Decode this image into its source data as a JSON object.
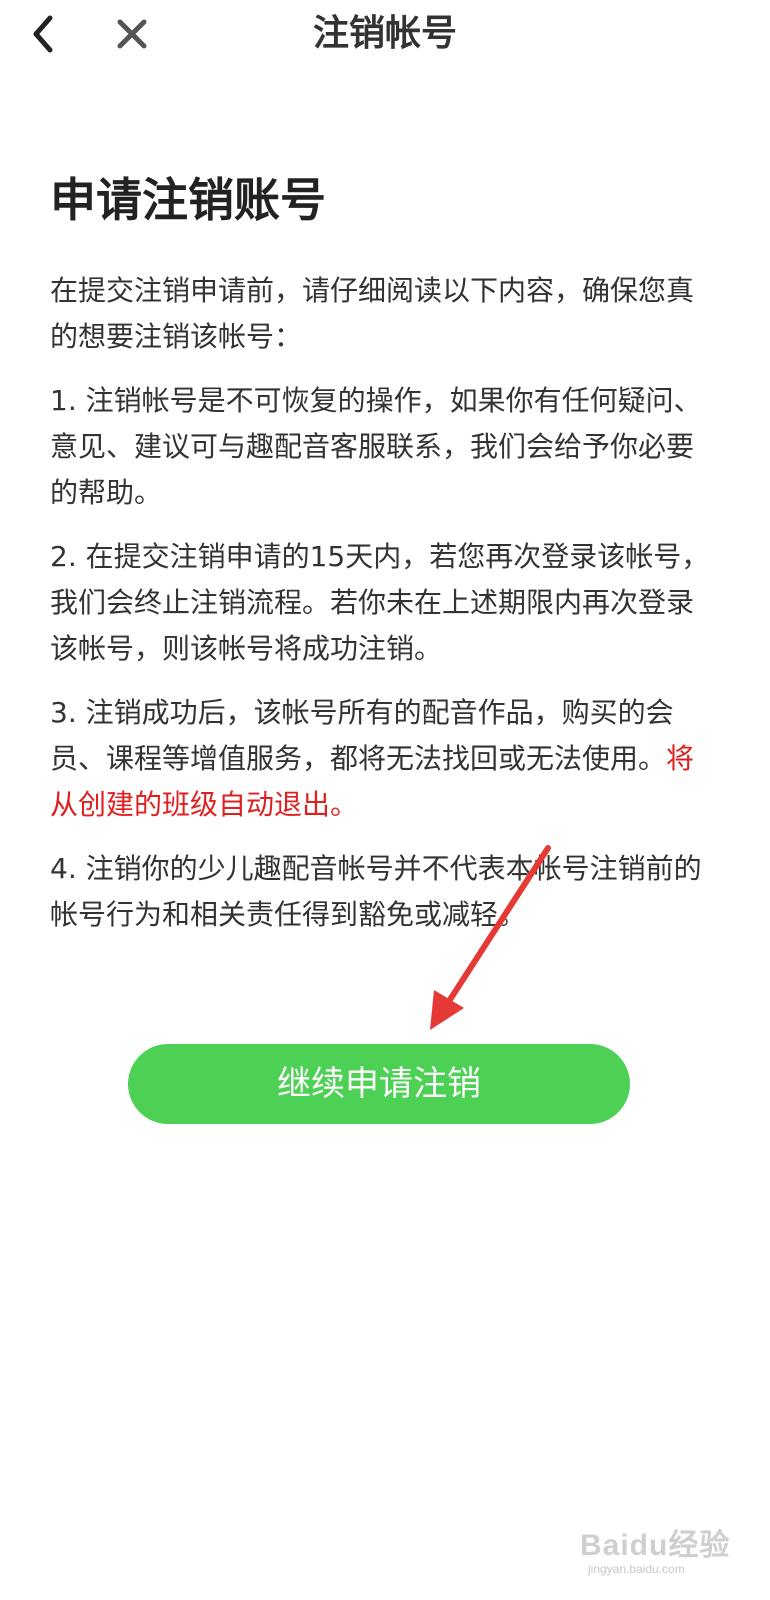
{
  "nav": {
    "title": "注销帐号",
    "back_icon": "chevron-left-icon",
    "close_icon": "close-icon"
  },
  "heading": "申请注销账号",
  "intro": "在提交注销申请前，请仔细阅读以下内容，确保您真的想要注销该帐号：",
  "items": [
    "1. 注销帐号是不可恢复的操作，如果你有任何疑问、意见、建议可与趣配音客服联系，我们会给予你必要的帮助。",
    "2. 在提交注销申请的15天内，若您再次登录该帐号，我们会终止注销流程。若你未在上述期限内再次登录该帐号，则该帐号将成功注销。",
    "3. 注销成功后，该帐号所有的配音作品，购买的会员、课程等增值服务，都将无法找回或无法使用。",
    "4. 注销你的少儿趣配音帐号并不代表本帐号注销前的帐号行为和相关责任得到豁免或减轻。"
  ],
  "item3_highlight": "将从创建的班级自动退出。",
  "continue_button": "继续申请注销",
  "colors": {
    "button": "#4cd154",
    "highlight": "#e02020",
    "annotation_arrow": "#e53935"
  },
  "watermark": {
    "logo": "Baidu经验",
    "sub": "jingyan.baidu.com"
  }
}
